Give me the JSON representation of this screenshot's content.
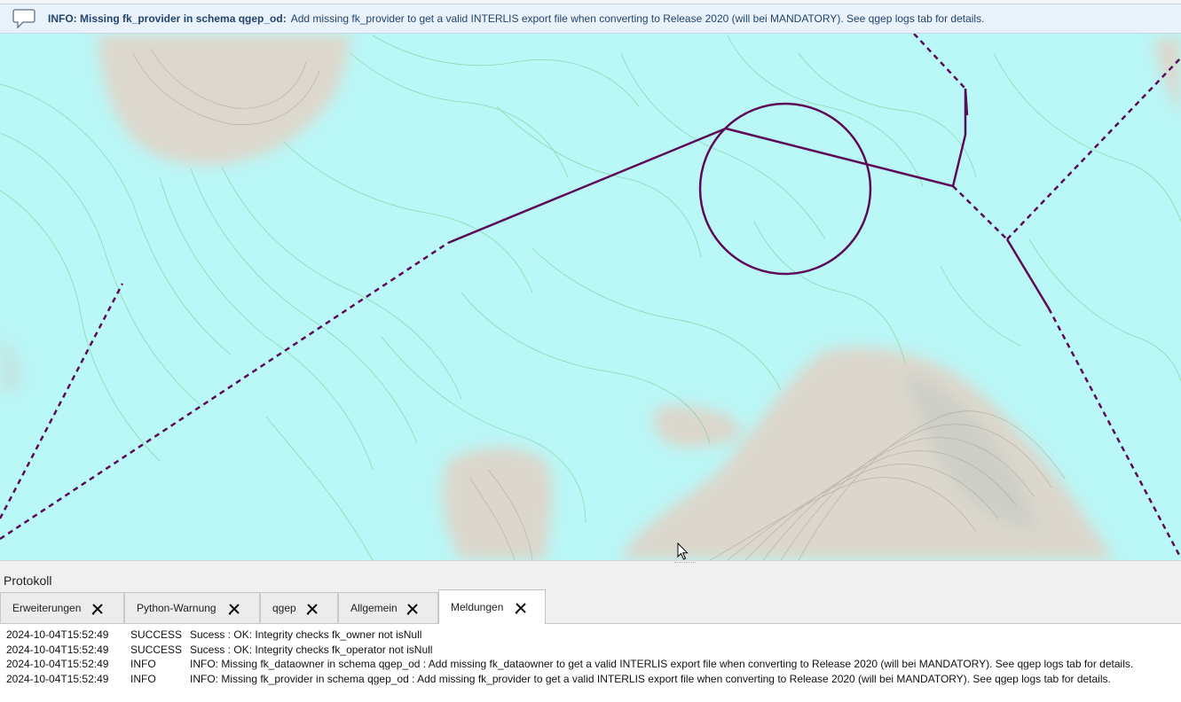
{
  "message_bar": {
    "title": "INFO: Missing fk_provider in schema qgep_od:",
    "text": "Add missing fk_provider to get a valid INTERLIS export file when converting to Release 2020 (will bei MANDATORY). See qgep logs tab for details.",
    "icon": "speech-bubble-icon"
  },
  "map": {
    "colors": {
      "water": "#baf7f7",
      "terrain": "#ddd9cf",
      "network": "#5d0b56",
      "contour": "#7fcf9a"
    }
  },
  "log_panel": {
    "title": "Protokoll",
    "tabs": [
      {
        "label": "Erweiterungen",
        "active": false
      },
      {
        "label": "Python-Warnung",
        "active": false
      },
      {
        "label": "qgep",
        "active": false
      },
      {
        "label": "Allgemein",
        "active": false
      },
      {
        "label": "Meldungen",
        "active": true
      }
    ],
    "entries": [
      {
        "timestamp": "2024-10-04T15:52:49",
        "level": "SUCCESS",
        "message": "Sucess : OK: Integrity checks fk_owner not isNull"
      },
      {
        "timestamp": "2024-10-04T15:52:49",
        "level": "SUCCESS",
        "message": "Sucess : OK: Integrity checks fk_operator not isNull"
      },
      {
        "timestamp": "2024-10-04T15:52:49",
        "level": "INFO",
        "message": "INFO: Missing fk_dataowner in schema qgep_od : Add missing fk_dataowner to get a valid INTERLIS export file when converting to Release 2020 (will bei MANDATORY). See qgep logs tab for details."
      },
      {
        "timestamp": "2024-10-04T15:52:49",
        "level": "INFO",
        "message": "INFO: Missing fk_provider in schema qgep_od : Add missing fk_provider to get a valid INTERLIS export file when converting to Release 2020 (will bei MANDATORY). See qgep logs tab for details."
      }
    ]
  }
}
